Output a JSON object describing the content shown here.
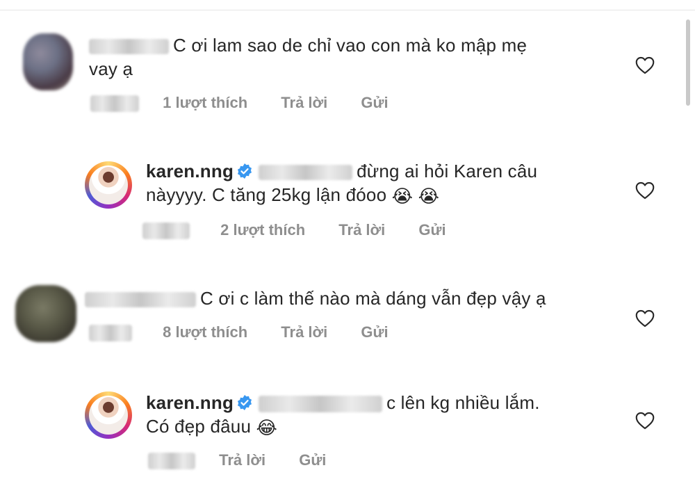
{
  "comments": [
    {
      "text_line1": "C ơi lam sao de chỉ vao con mà ko mập mẹ",
      "text_line2": "vay ạ",
      "likes": "1 lượt thích",
      "reply": "Trả lời",
      "send": "Gửi"
    },
    {
      "username": "karen.nng",
      "text_line1": "đừng ai hỏi Karen câu",
      "text_line2": "nàyyyy. C tăng 25kg lận đóoo",
      "emojis": "😭 😭",
      "likes": "2 lượt thích",
      "reply": "Trả lời",
      "send": "Gửi"
    },
    {
      "text_line1": "C ơi c làm thế nào mà dáng vẫn đẹp vậy ạ",
      "likes": "8 lượt thích",
      "reply": "Trả lời",
      "send": "Gửi"
    },
    {
      "username": "karen.nng",
      "text_line1": "c lên kg nhiều lắm.",
      "text_line2": "Có đẹp đâuu",
      "emojis": "😂",
      "reply": "Trả lời",
      "send": "Gửi"
    }
  ],
  "icons": {
    "like": "heart-outline-icon",
    "verified": "verified-badge-icon"
  },
  "colors": {
    "verified": "#3897f0",
    "text": "#262626",
    "meta": "#8e8e8e"
  }
}
